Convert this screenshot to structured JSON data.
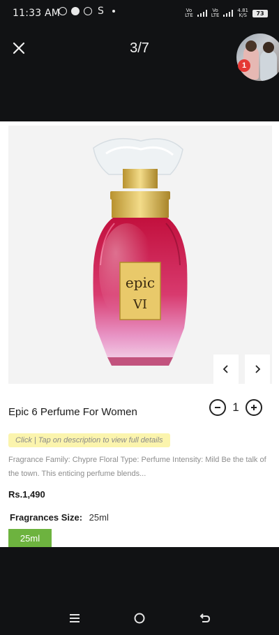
{
  "status_bar": {
    "time": "11:33 AM",
    "net_speed_value": "4.81",
    "net_speed_unit": "K/S",
    "battery": "73"
  },
  "viewer": {
    "counter": "3/7",
    "notification_count": "1"
  },
  "product": {
    "title": "Epic 6 Perfume For Women",
    "quantity": "1",
    "hint": "Click | Tap on description to view full details",
    "description": "Fragrance Family: Chypre Floral Type: Perfume Intensity: Mild Be the talk of the town. This enticing perfume blends...",
    "price": "Rs.1,490",
    "size_label": "Fragrances Size:",
    "size_value": "25ml",
    "size_option": "25ml",
    "label_line1": "epic",
    "label_line2": "VI"
  },
  "colors": {
    "size_chip": "#6db33f",
    "hint_bg": "#fbf4ad",
    "badge": "#e53935"
  }
}
